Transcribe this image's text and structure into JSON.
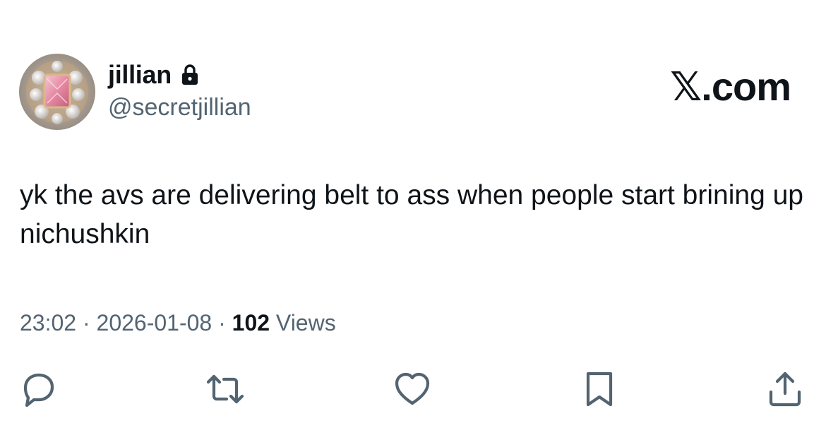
{
  "author": {
    "display_name": "jillian",
    "handle": "@secretjillian",
    "protected_icon": "lock-icon",
    "avatar_icon": "pink-gem-ring"
  },
  "brand": {
    "label": "𝕏.com"
  },
  "tweet": {
    "text": "yk the avs are delivering belt to ass when people start brining up nichushkin"
  },
  "meta": {
    "time": "23:02",
    "separator": "·",
    "date": "2026-01-08",
    "views_count": "102",
    "views_label": "Views"
  },
  "actions": {
    "reply_icon": "reply-icon",
    "repost_icon": "repost-icon",
    "like_icon": "heart-icon",
    "bookmark_icon": "bookmark-icon",
    "share_icon": "share-icon"
  },
  "colors": {
    "text_primary": "#0f1419",
    "text_secondary": "#536471",
    "icon": "#536471",
    "background": "#ffffff"
  }
}
